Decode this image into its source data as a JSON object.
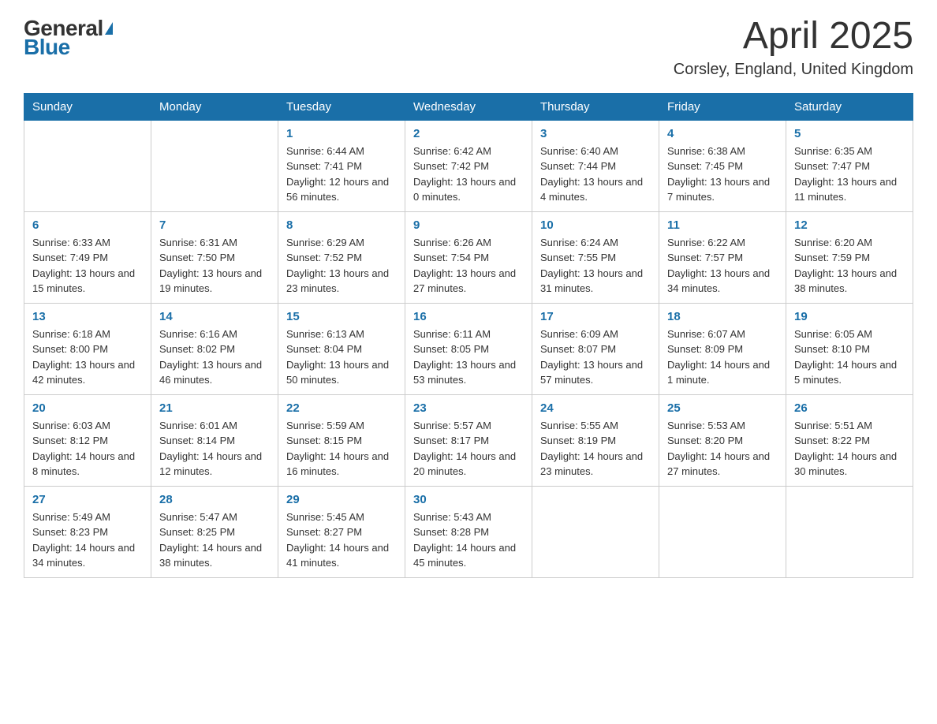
{
  "logo": {
    "general": "General",
    "blue": "Blue"
  },
  "header": {
    "title": "April 2025",
    "subtitle": "Corsley, England, United Kingdom"
  },
  "weekdays": [
    "Sunday",
    "Monday",
    "Tuesday",
    "Wednesday",
    "Thursday",
    "Friday",
    "Saturday"
  ],
  "weeks": [
    [
      null,
      null,
      {
        "day": "1",
        "sunrise": "Sunrise: 6:44 AM",
        "sunset": "Sunset: 7:41 PM",
        "daylight": "Daylight: 12 hours and 56 minutes."
      },
      {
        "day": "2",
        "sunrise": "Sunrise: 6:42 AM",
        "sunset": "Sunset: 7:42 PM",
        "daylight": "Daylight: 13 hours and 0 minutes."
      },
      {
        "day": "3",
        "sunrise": "Sunrise: 6:40 AM",
        "sunset": "Sunset: 7:44 PM",
        "daylight": "Daylight: 13 hours and 4 minutes."
      },
      {
        "day": "4",
        "sunrise": "Sunrise: 6:38 AM",
        "sunset": "Sunset: 7:45 PM",
        "daylight": "Daylight: 13 hours and 7 minutes."
      },
      {
        "day": "5",
        "sunrise": "Sunrise: 6:35 AM",
        "sunset": "Sunset: 7:47 PM",
        "daylight": "Daylight: 13 hours and 11 minutes."
      }
    ],
    [
      {
        "day": "6",
        "sunrise": "Sunrise: 6:33 AM",
        "sunset": "Sunset: 7:49 PM",
        "daylight": "Daylight: 13 hours and 15 minutes."
      },
      {
        "day": "7",
        "sunrise": "Sunrise: 6:31 AM",
        "sunset": "Sunset: 7:50 PM",
        "daylight": "Daylight: 13 hours and 19 minutes."
      },
      {
        "day": "8",
        "sunrise": "Sunrise: 6:29 AM",
        "sunset": "Sunset: 7:52 PM",
        "daylight": "Daylight: 13 hours and 23 minutes."
      },
      {
        "day": "9",
        "sunrise": "Sunrise: 6:26 AM",
        "sunset": "Sunset: 7:54 PM",
        "daylight": "Daylight: 13 hours and 27 minutes."
      },
      {
        "day": "10",
        "sunrise": "Sunrise: 6:24 AM",
        "sunset": "Sunset: 7:55 PM",
        "daylight": "Daylight: 13 hours and 31 minutes."
      },
      {
        "day": "11",
        "sunrise": "Sunrise: 6:22 AM",
        "sunset": "Sunset: 7:57 PM",
        "daylight": "Daylight: 13 hours and 34 minutes."
      },
      {
        "day": "12",
        "sunrise": "Sunrise: 6:20 AM",
        "sunset": "Sunset: 7:59 PM",
        "daylight": "Daylight: 13 hours and 38 minutes."
      }
    ],
    [
      {
        "day": "13",
        "sunrise": "Sunrise: 6:18 AM",
        "sunset": "Sunset: 8:00 PM",
        "daylight": "Daylight: 13 hours and 42 minutes."
      },
      {
        "day": "14",
        "sunrise": "Sunrise: 6:16 AM",
        "sunset": "Sunset: 8:02 PM",
        "daylight": "Daylight: 13 hours and 46 minutes."
      },
      {
        "day": "15",
        "sunrise": "Sunrise: 6:13 AM",
        "sunset": "Sunset: 8:04 PM",
        "daylight": "Daylight: 13 hours and 50 minutes."
      },
      {
        "day": "16",
        "sunrise": "Sunrise: 6:11 AM",
        "sunset": "Sunset: 8:05 PM",
        "daylight": "Daylight: 13 hours and 53 minutes."
      },
      {
        "day": "17",
        "sunrise": "Sunrise: 6:09 AM",
        "sunset": "Sunset: 8:07 PM",
        "daylight": "Daylight: 13 hours and 57 minutes."
      },
      {
        "day": "18",
        "sunrise": "Sunrise: 6:07 AM",
        "sunset": "Sunset: 8:09 PM",
        "daylight": "Daylight: 14 hours and 1 minute."
      },
      {
        "day": "19",
        "sunrise": "Sunrise: 6:05 AM",
        "sunset": "Sunset: 8:10 PM",
        "daylight": "Daylight: 14 hours and 5 minutes."
      }
    ],
    [
      {
        "day": "20",
        "sunrise": "Sunrise: 6:03 AM",
        "sunset": "Sunset: 8:12 PM",
        "daylight": "Daylight: 14 hours and 8 minutes."
      },
      {
        "day": "21",
        "sunrise": "Sunrise: 6:01 AM",
        "sunset": "Sunset: 8:14 PM",
        "daylight": "Daylight: 14 hours and 12 minutes."
      },
      {
        "day": "22",
        "sunrise": "Sunrise: 5:59 AM",
        "sunset": "Sunset: 8:15 PM",
        "daylight": "Daylight: 14 hours and 16 minutes."
      },
      {
        "day": "23",
        "sunrise": "Sunrise: 5:57 AM",
        "sunset": "Sunset: 8:17 PM",
        "daylight": "Daylight: 14 hours and 20 minutes."
      },
      {
        "day": "24",
        "sunrise": "Sunrise: 5:55 AM",
        "sunset": "Sunset: 8:19 PM",
        "daylight": "Daylight: 14 hours and 23 minutes."
      },
      {
        "day": "25",
        "sunrise": "Sunrise: 5:53 AM",
        "sunset": "Sunset: 8:20 PM",
        "daylight": "Daylight: 14 hours and 27 minutes."
      },
      {
        "day": "26",
        "sunrise": "Sunrise: 5:51 AM",
        "sunset": "Sunset: 8:22 PM",
        "daylight": "Daylight: 14 hours and 30 minutes."
      }
    ],
    [
      {
        "day": "27",
        "sunrise": "Sunrise: 5:49 AM",
        "sunset": "Sunset: 8:23 PM",
        "daylight": "Daylight: 14 hours and 34 minutes."
      },
      {
        "day": "28",
        "sunrise": "Sunrise: 5:47 AM",
        "sunset": "Sunset: 8:25 PM",
        "daylight": "Daylight: 14 hours and 38 minutes."
      },
      {
        "day": "29",
        "sunrise": "Sunrise: 5:45 AM",
        "sunset": "Sunset: 8:27 PM",
        "daylight": "Daylight: 14 hours and 41 minutes."
      },
      {
        "day": "30",
        "sunrise": "Sunrise: 5:43 AM",
        "sunset": "Sunset: 8:28 PM",
        "daylight": "Daylight: 14 hours and 45 minutes."
      },
      null,
      null,
      null
    ]
  ]
}
